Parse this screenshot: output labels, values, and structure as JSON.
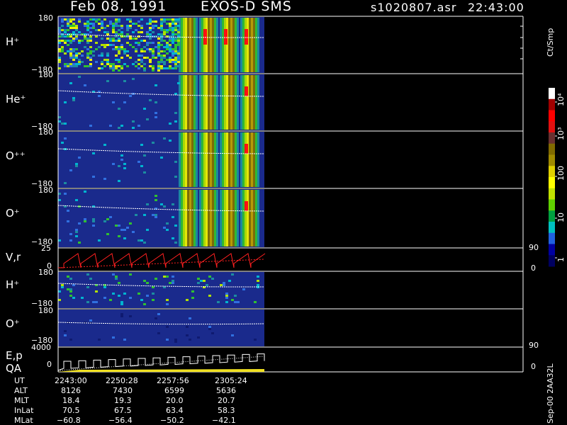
{
  "header": {
    "date": "Feb 08, 1991",
    "instrument": "EXOS-D SMS",
    "file": "s1020807.asr",
    "time": "22:43:00"
  },
  "colorbar": {
    "unit": "Ct/Smp",
    "labels": [
      "10⁴",
      "10³",
      "100",
      "10",
      "1"
    ],
    "colors": [
      "#ffffff",
      "#a00000",
      "#ff0000",
      "#e01010",
      "#6a3030",
      "#806a00",
      "#a08a00",
      "#e0d000",
      "#ffff00",
      "#c0e000",
      "#60d000",
      "#00a040",
      "#00c0c0",
      "#2060e0",
      "#0000a0",
      "#000060"
    ]
  },
  "panels": [
    {
      "id": "h-plus-1",
      "label": "H⁺",
      "tick_top": "180",
      "tick_bottom": "−180"
    },
    {
      "id": "he-plus",
      "label": "He⁺",
      "tick_top": "180",
      "tick_bottom": "−180"
    },
    {
      "id": "o-plus-plus",
      "label": "O⁺⁺",
      "tick_top": "180",
      "tick_bottom": "−180"
    },
    {
      "id": "o-plus-1",
      "label": "O⁺",
      "tick_top": "180",
      "tick_bottom": "−180"
    },
    {
      "id": "v-r",
      "label": "V,r",
      "tick_top": "25",
      "tick_bottom": "0",
      "right_top": "90",
      "right_bottom": "0"
    },
    {
      "id": "h-plus-2",
      "label": "H⁺",
      "tick_top": "180",
      "tick_bottom": "−180"
    },
    {
      "id": "o-plus-2",
      "label": "O⁺",
      "tick_top": "180",
      "tick_bottom": "−180"
    },
    {
      "id": "e-p",
      "label": "E,p",
      "label2": "QA",
      "tick_top": "4000",
      "tick_bottom": "0",
      "right_top": "90",
      "right_bottom": "0"
    }
  ],
  "footer": {
    "row_labels": [
      "UT",
      "ALT",
      "MLT",
      "InLat",
      "MLat"
    ],
    "columns": [
      {
        "UT": "2243:00",
        "ALT": "8126",
        "MLT": "18.4",
        "InLat": "70.5",
        "MLat": "−60.8"
      },
      {
        "UT": "2250:28",
        "ALT": "7430",
        "MLT": "19.3",
        "InLat": "67.5",
        "MLat": "−56.4"
      },
      {
        "UT": "2257:56",
        "ALT": "6599",
        "MLT": "20.0",
        "InLat": "63.4",
        "MLat": "−50.2"
      },
      {
        "UT": "2305:24",
        "ALT": "5636",
        "MLT": "20.7",
        "InLat": "58.3",
        "MLat": "−42.1"
      }
    ],
    "side_text": "Sep-00 2AA32L"
  },
  "chart_data": {
    "type": "heatmap",
    "title": "Feb 08, 1991   EXOS-D SMS",
    "time_ticks": [
      "2243:00",
      "2250:28",
      "2257:56",
      "2305:24"
    ],
    "yaxis_range": [
      -180,
      180
    ],
    "data_coverage_end": "≈2310",
    "colorscale": {
      "unit": "Ct/Smp",
      "scale": "log",
      "range": [
        1,
        10000
      ]
    },
    "panels": [
      "H⁺",
      "He⁺",
      "O⁺⁺",
      "O⁺",
      "V,r",
      "H⁺",
      "O⁺",
      "E,p / QA"
    ]
  }
}
